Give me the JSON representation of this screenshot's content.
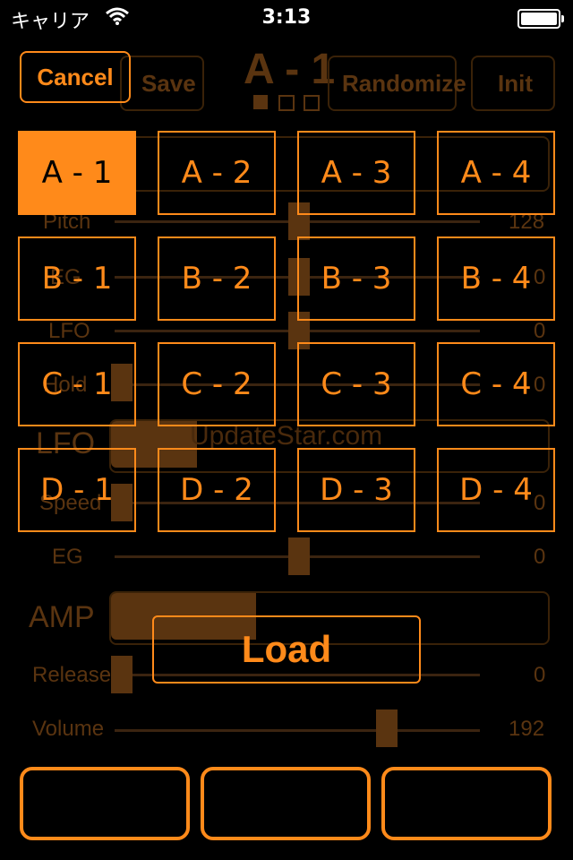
{
  "status": {
    "carrier": "キャリア",
    "time": "3:13"
  },
  "header": {
    "cancel": "Cancel",
    "load_dim": "Load",
    "save": "Save",
    "title": "A - 1",
    "randomize": "Randomize",
    "init": "Init"
  },
  "background": {
    "pitch_label": "Pitch",
    "pitch_value": "128",
    "eg_label": "EG",
    "eg_value": "0",
    "lfo_label": "LFO",
    "lfo_value": "0",
    "hold_label": "Hold",
    "hold_value": "0",
    "lfo_section": "LFO",
    "speed_label": "Speed",
    "speed_value": "0",
    "eg2_label": "EG",
    "eg2_value": "0",
    "amp_section": "AMP",
    "release_label": "Release",
    "release_value": "0",
    "volume_label": "Volume",
    "volume_value": "192",
    "watermark": "UpdateStar.com"
  },
  "patches": [
    [
      "A - 1",
      "A - 2",
      "A - 3",
      "A - 4"
    ],
    [
      "B - 1",
      "B - 2",
      "B - 3",
      "B - 4"
    ],
    [
      "C - 1",
      "C - 2",
      "C - 3",
      "C - 4"
    ],
    [
      "D - 1",
      "D - 2",
      "D - 3",
      "D - 4"
    ]
  ],
  "selected_patch": "A - 1",
  "load_button": "Load",
  "colors": {
    "accent": "#ff8a1a",
    "background": "#000000"
  }
}
